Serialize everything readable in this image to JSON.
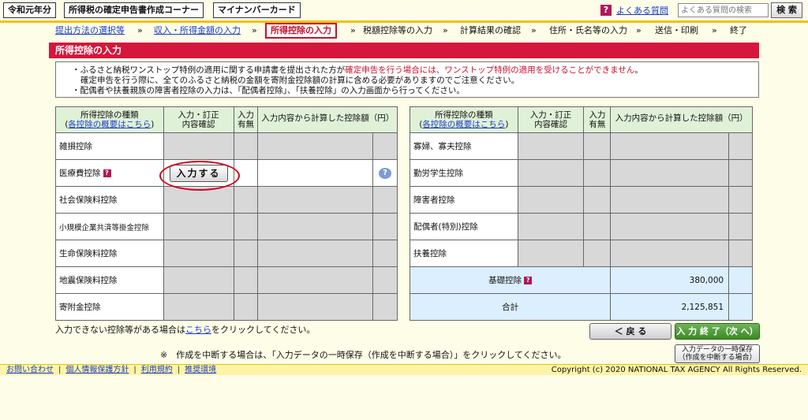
{
  "header": {
    "era_label": "令和元年分",
    "corner_title": "所得税の確定申告書作成コーナー",
    "mynumber_label": "マイナンバーカード",
    "faq_icon": "?",
    "faq_link": "よくある質問",
    "search_placeholder": "よくある質問の検索",
    "search_button": "検 索"
  },
  "breadcrumb": {
    "steps": [
      "提出方法の選択等",
      "収入・所得金額の入力",
      "所得控除の入力",
      "税額控除等の入力",
      "計算結果の確認",
      "住所・氏名等の入力",
      "送信・印刷",
      "終了"
    ],
    "separator": "»"
  },
  "page_title": "所得控除の入力",
  "notice": {
    "line1_bullet": "・",
    "line1_normal": "ふるさと納税ワンストップ特例の適用に関する申請書を提出された方が",
    "line1_red": "確定申告を行う場合には、ワンストップ特例の適用を受けることができません",
    "line1_end": "。",
    "line2": "確定申告を行う際に、全てのふるさと納税の金額を寄附金控除額の計算に含める必要がありますのでご注意ください。",
    "line3_bullet": "・",
    "line3": "配偶者や扶養親族の障害者控除の入力は、「配偶者控除」、「扶養控除」の入力画面から行ってください。"
  },
  "table_headers": {
    "type": "所得控除の種類",
    "overview_link": "各控除の概要はこちら",
    "edit_line1": "入力・訂正",
    "edit_line2": "内容確認",
    "has_line1": "入力",
    "has_line2": "有無",
    "amount": "入力内容から計算した控除額（円）",
    "lparen": "(",
    "rparen": ")"
  },
  "left_rows": [
    {
      "label": "雑損控除"
    },
    {
      "label": "医療費控除",
      "button": "入力する",
      "help": "?"
    },
    {
      "label": "社会保険料控除"
    },
    {
      "label": "小規模企業共済等掛金控除"
    },
    {
      "label": "生命保険料控除"
    },
    {
      "label": "地震保険料控除"
    },
    {
      "label": "寄附金控除"
    }
  ],
  "right_rows": [
    {
      "label": "寡婦、寡夫控除"
    },
    {
      "label": "勤労学生控除"
    },
    {
      "label": "障害者控除"
    },
    {
      "label": "配偶者(特別)控除"
    },
    {
      "label": "扶養控除"
    }
  ],
  "summary": {
    "basic_label": "基礎控除",
    "basic_value": "380,000",
    "total_label": "合計",
    "total_value": "2,125,851",
    "help_icon": "?"
  },
  "notes": {
    "cant_input_pre": "入力できない控除等がある場合は",
    "cant_input_link": "こちら",
    "cant_input_post": "をクリックしてください。",
    "save_note": "※　作成を中断する場合は、「入力データの一時保存（作成を中断する場合）」をクリックしてください。"
  },
  "buttons": {
    "back": "＜ 戻 る",
    "next": "入 力 終 了（次 へ）＞",
    "temp_save_line1": "入力データの一時保存",
    "temp_save_line2": "（作成を中断する場合）"
  },
  "footer": {
    "links": [
      "お問い合わせ",
      "個人情報保護方針",
      "利用規約",
      "推奨環境"
    ],
    "separator": "|",
    "copyright": "Copyright (c) 2020 NATIONAL TAX AGENCY All Rights Reserved."
  },
  "colors": {
    "accent_red": "#d6163c",
    "header_green": "#dff2d8",
    "summary_blue": "#dcefff",
    "link_blue": "#1a3ccf"
  }
}
